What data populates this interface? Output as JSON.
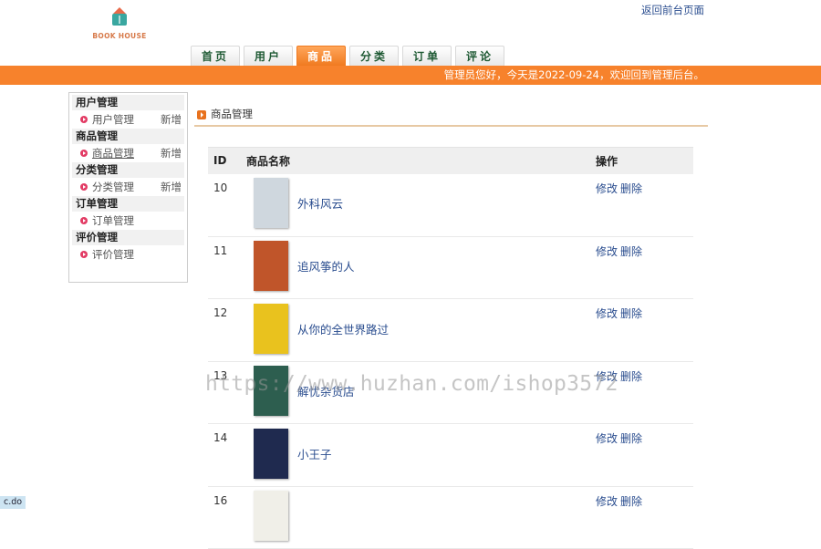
{
  "logo": {
    "text": "BOOK HOUSE"
  },
  "header": {
    "back_link": "返回前台页面"
  },
  "tabs": [
    {
      "label": "首页",
      "active": false
    },
    {
      "label": "用户",
      "active": false
    },
    {
      "label": "商品",
      "active": true
    },
    {
      "label": "分类",
      "active": false
    },
    {
      "label": "订单",
      "active": false
    },
    {
      "label": "评论",
      "active": false
    }
  ],
  "banner": {
    "text": "管理员您好，今天是2022-09-24，欢迎回到管理后台。"
  },
  "sidebar": {
    "groups": [
      {
        "title": "用户管理",
        "item": "用户管理",
        "new": "新增"
      },
      {
        "title": "商品管理",
        "item": "商品管理",
        "new": "新增"
      },
      {
        "title": "分类管理",
        "item": "分类管理",
        "new": "新增"
      },
      {
        "title": "订单管理",
        "item": "订单管理"
      },
      {
        "title": "评价管理",
        "item": "评价管理"
      }
    ]
  },
  "content": {
    "title": "商品管理",
    "columns": {
      "id": "ID",
      "name": "商品名称",
      "ops": "操作"
    },
    "op_edit": "修改",
    "op_delete": "删除",
    "rows": [
      {
        "id": "10",
        "name": "外科风云",
        "cover_color": "#cfd7de"
      },
      {
        "id": "11",
        "name": "追风筝的人",
        "cover_color": "#c0552a"
      },
      {
        "id": "12",
        "name": "从你的全世界路过",
        "cover_color": "#e9c21e"
      },
      {
        "id": "13",
        "name": "解忧杂货店",
        "cover_color": "#2d5e4f"
      },
      {
        "id": "14",
        "name": "小王子",
        "cover_color": "#1f2a4f"
      },
      {
        "id": "16",
        "name": "",
        "cover_color": "#f0efe8"
      }
    ]
  },
  "watermark": "https://www.huzhan.com/ishop3572",
  "statusbar": {
    "text": "c.do"
  }
}
